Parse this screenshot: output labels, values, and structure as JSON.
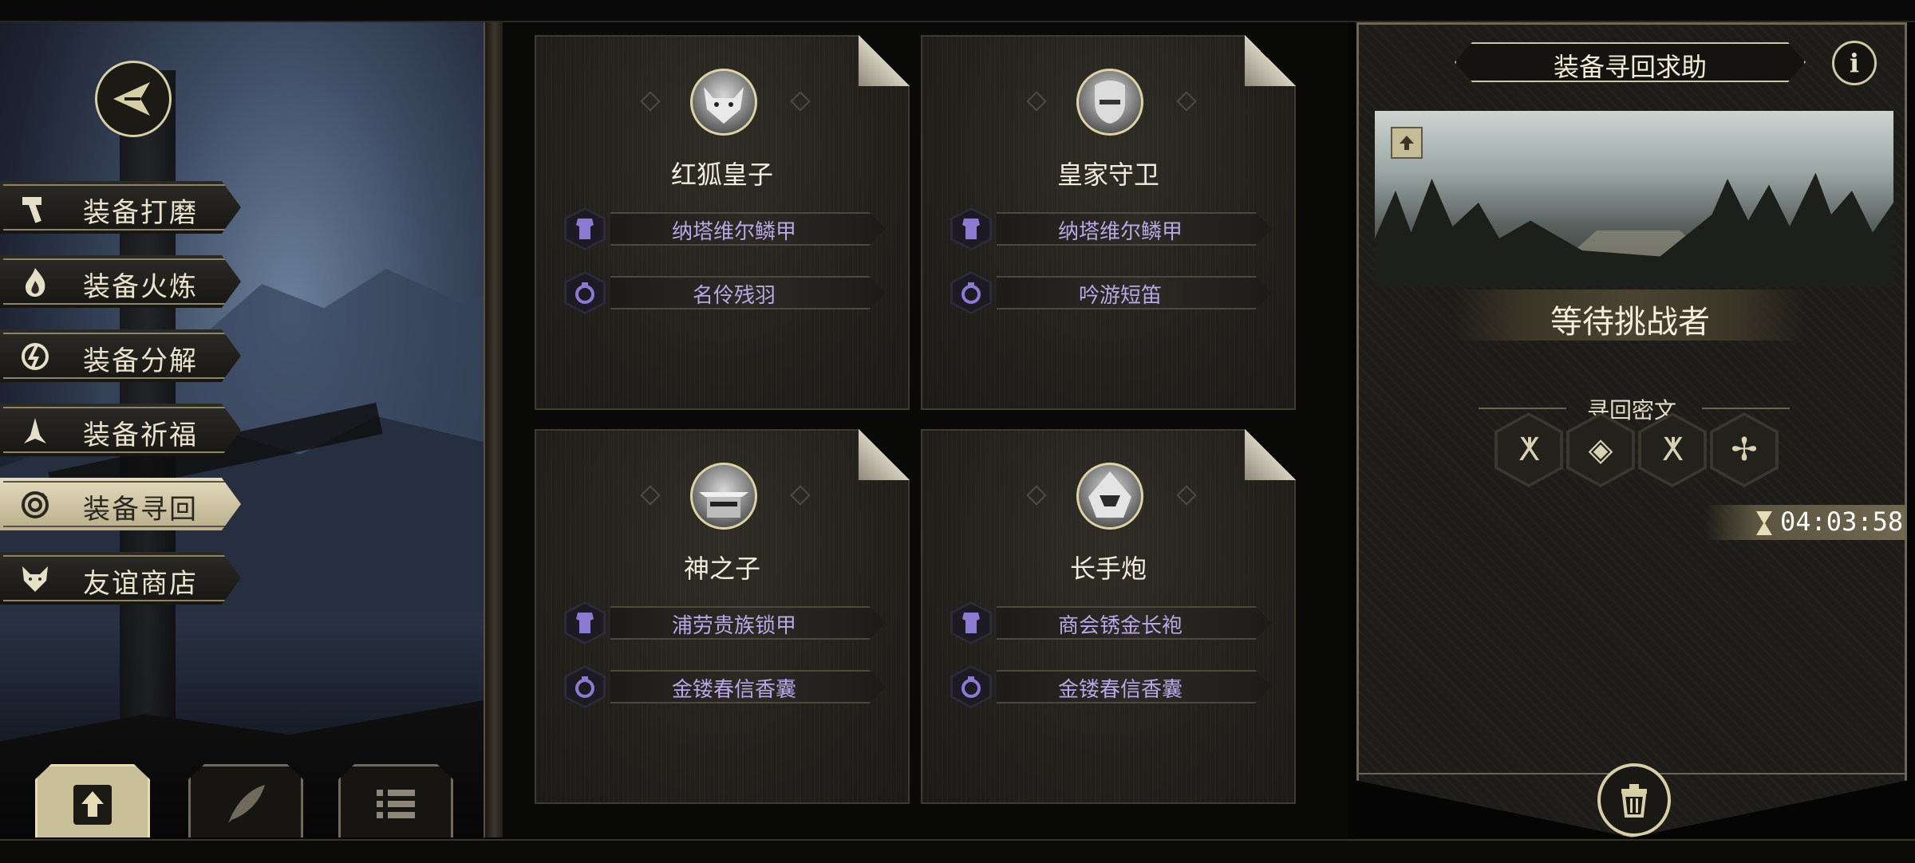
{
  "left_menu": {
    "items": [
      {
        "label": "装备打磨",
        "icon": "hammer-icon"
      },
      {
        "label": "装备火炼",
        "icon": "flame-icon"
      },
      {
        "label": "装备分解",
        "icon": "decompose-icon"
      },
      {
        "label": "装备祈福",
        "icon": "pray-icon"
      },
      {
        "label": "装备寻回",
        "icon": "retrieve-icon",
        "active": true
      },
      {
        "label": "友谊商店",
        "icon": "fox-icon"
      }
    ],
    "back_icon": "back-arrow-icon"
  },
  "bottom_tabs": [
    {
      "icon": "upload-icon",
      "active": true
    },
    {
      "icon": "feather-icon",
      "active": false
    },
    {
      "icon": "list-icon",
      "active": false
    }
  ],
  "cards": [
    {
      "name": "红狐皇子",
      "avatar": "fox-portrait",
      "equipment": [
        {
          "type": "armor-icon",
          "name": "纳塔维尔鳞甲"
        },
        {
          "type": "ring-icon",
          "name": "名伶残羽"
        }
      ]
    },
    {
      "name": "皇家守卫",
      "avatar": "guard-portrait",
      "equipment": [
        {
          "type": "armor-icon",
          "name": "纳塔维尔鳞甲"
        },
        {
          "type": "ring-icon",
          "name": "吟游短笛"
        }
      ]
    },
    {
      "name": "神之子",
      "avatar": "masked-portrait",
      "equipment": [
        {
          "type": "armor-icon",
          "name": "浦劳贵族锁甲"
        },
        {
          "type": "ring-icon",
          "name": "金镂春信香囊"
        }
      ]
    },
    {
      "name": "长手炮",
      "avatar": "hooded-portrait",
      "equipment": [
        {
          "type": "armor-icon",
          "name": "商会锈金长袍"
        },
        {
          "type": "ring-icon",
          "name": "金镂春信香囊"
        }
      ]
    }
  ],
  "right_panel": {
    "title": "装备寻回求助",
    "info_label": "i",
    "status": "等待挑战者",
    "subheading": "寻回密文",
    "runes": [
      "ⵅ",
      "◈",
      "ⵅ",
      "✢"
    ],
    "timer": "04:03:58"
  },
  "colors": {
    "accent_gold": "#d8cfa8",
    "equip_text": "#b9a7e6",
    "panel_bg": "#1e1c18"
  }
}
